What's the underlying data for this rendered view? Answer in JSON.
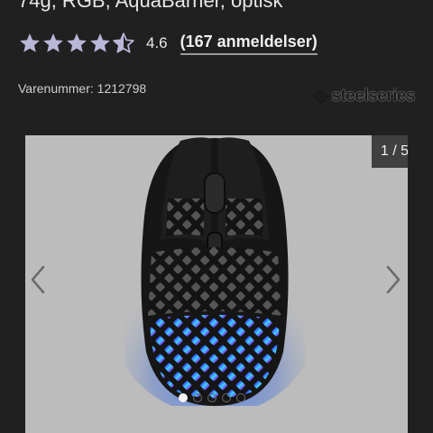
{
  "product": {
    "title_partial": "74g, RGB, AquaBarrier, optisk",
    "rating_value": "4.6",
    "rating_stars": 4.5,
    "reviews_link": "(167 anmeldelser)",
    "sku": "Varenummer: 1212798",
    "brand": "steelseries"
  },
  "gallery": {
    "counter": "1 / 5",
    "slides_total": 5,
    "active_index": 0,
    "prev_icon": "chevron-left-icon",
    "next_icon": "chevron-right-icon"
  },
  "colors": {
    "background": "#202020",
    "star_fill": "#b9b6d8",
    "gallery_bg": "#bcbcbc"
  }
}
